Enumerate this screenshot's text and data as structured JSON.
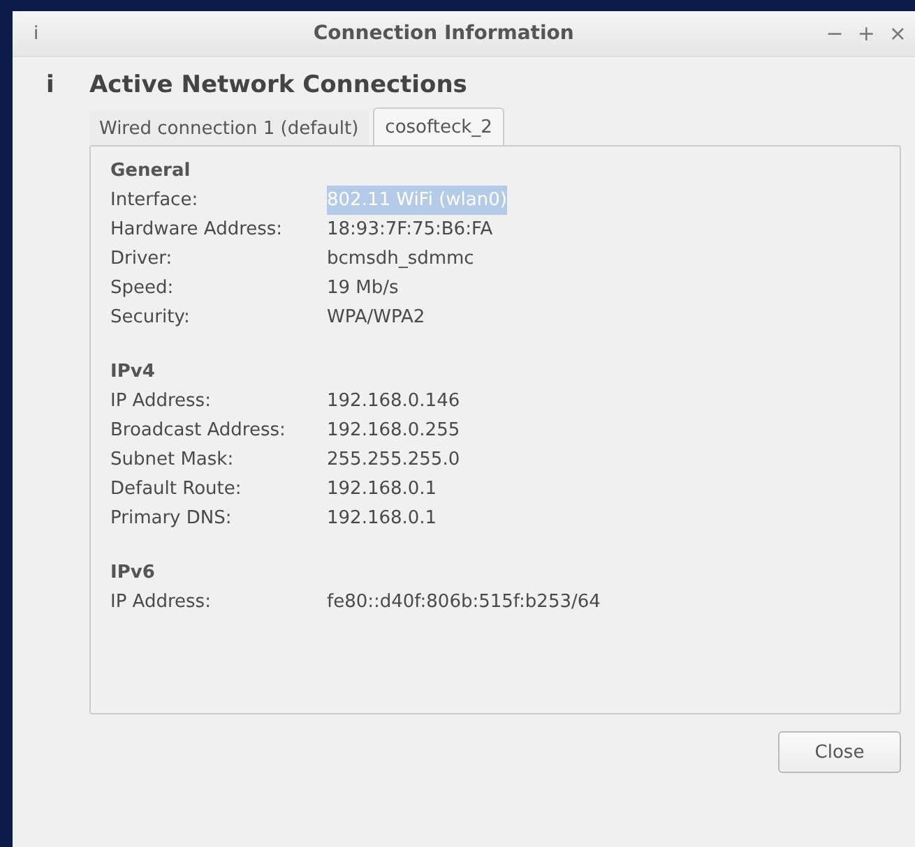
{
  "window": {
    "icon": "i",
    "title": "Connection Information",
    "controls": [
      "−",
      "+",
      "×"
    ]
  },
  "header": {
    "icon": "i",
    "title": "Active Network Connections"
  },
  "tabs": [
    {
      "label": "Wired connection 1 (default)",
      "selected": false
    },
    {
      "label": "cosofteck_2",
      "selected": true
    }
  ],
  "sections": [
    {
      "title": "General",
      "rows": [
        {
          "label": "Interface:",
          "value": "802.11 WiFi (wlan0)",
          "highlighted": true
        },
        {
          "label": "Hardware Address:",
          "value": "18:93:7F:75:B6:FA",
          "highlighted": false
        },
        {
          "label": "Driver:",
          "value": "bcmsdh_sdmmc",
          "highlighted": false
        },
        {
          "label": "Speed:",
          "value": "19 Mb/s",
          "highlighted": false
        },
        {
          "label": "Security:",
          "value": "WPA/WPA2",
          "highlighted": false
        }
      ]
    },
    {
      "title": "IPv4",
      "rows": [
        {
          "label": "IP Address:",
          "value": "192.168.0.146",
          "highlighted": false
        },
        {
          "label": "Broadcast Address:",
          "value": "192.168.0.255",
          "highlighted": false
        },
        {
          "label": "Subnet Mask:",
          "value": "255.255.255.0",
          "highlighted": false
        },
        {
          "label": "Default Route:",
          "value": "192.168.0.1",
          "highlighted": false
        },
        {
          "label": "Primary DNS:",
          "value": "192.168.0.1",
          "highlighted": false
        }
      ]
    },
    {
      "title": "IPv6",
      "rows": [
        {
          "label": "IP Address:",
          "value": "fe80::d40f:806b:515f:b253/64",
          "highlighted": false
        }
      ]
    }
  ],
  "buttons": [
    "Close"
  ]
}
